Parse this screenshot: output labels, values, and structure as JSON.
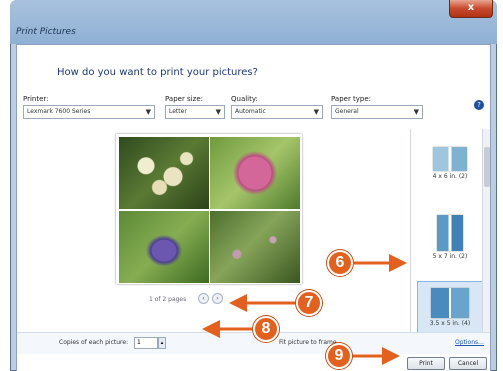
{
  "window": {
    "title": "Print Pictures",
    "close_label": "x"
  },
  "prompt": "How do you want to print your pictures?",
  "fields": {
    "printer": {
      "label": "Printer:",
      "value": "Lexmark 7600 Series"
    },
    "paper_size": {
      "label": "Paper size:",
      "value": "Letter"
    },
    "quality": {
      "label": "Quality:",
      "value": "Automatic"
    },
    "paper_type": {
      "label": "Paper type:",
      "value": "General"
    }
  },
  "help_label": "?",
  "pager": {
    "text": "1 of 2 pages",
    "prev": "‹",
    "next": "›"
  },
  "layouts": [
    {
      "caption": "4 x 6 in. (2)"
    },
    {
      "caption": "5 x 7 in. (2)"
    },
    {
      "caption": "3.5 x 5 in. (4)"
    }
  ],
  "copies": {
    "label": "Copies of each picture:",
    "value": "1",
    "fit_label": "Fit picture to frame"
  },
  "options_link": "Options...",
  "buttons": {
    "print": "Print",
    "cancel": "Cancel"
  },
  "callouts": {
    "c6": "6",
    "c7": "7",
    "c8": "8",
    "c9": "9"
  },
  "colors": {
    "callout": "#e2611f",
    "title_bar": "#8fb0d4",
    "prompt_text": "#1e3a78"
  }
}
